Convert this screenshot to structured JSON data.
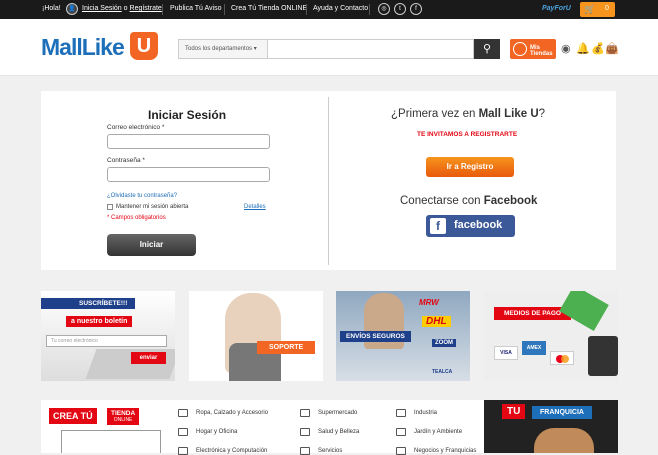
{
  "topbar": {
    "hola": "¡Hola!",
    "inicia": "Inicia Sesión",
    "o": "o",
    "registrate": "Regístrate",
    "publica": "Publica Tú Aviso",
    "crea": "Crea Tú Tienda ONLINE",
    "ayuda": "Ayuda y Contacto",
    "payforu": "PayForU",
    "cart_count": "0",
    "social": [
      "instagram",
      "twitter",
      "facebook"
    ]
  },
  "header": {
    "logo": "MallLike",
    "logo_u": "U",
    "search_dept": "Todos los departamentos",
    "search_placeholder": "",
    "mis_tiendas": "Mis Tiendas"
  },
  "login": {
    "title": "Iniciar Sesión",
    "email_label": "Correo electrónico *",
    "email_value": "",
    "password_label": "Contraseña *",
    "password_value": "",
    "forgot": "¿Olvidaste tu contraseña?",
    "keep": "Mantener mi sesión abierta",
    "details": "Detalles",
    "required": "* Campos obligatorios",
    "submit": "Iniciar"
  },
  "register": {
    "question_pre": "¿Primera vez en",
    "question_brand": "Mall Like U",
    "question_post": "?",
    "invite": "TE INVITAMOS A REGISTRARTE",
    "btn": "Ir a Registro",
    "fb_text": "Conectarse con",
    "fb_bold": "Facebook",
    "fb_btn": "facebook"
  },
  "banners": {
    "newsletter_l1": "SUSCRÍBETE!!!",
    "newsletter_l2": "a nuestro boletín",
    "newsletter_placeholder": "Tu correo electrónico",
    "newsletter_btn": "enviar",
    "soporte": "SOPORTE",
    "envios": "ENVÍOS SEGUROS",
    "mrw": "MRW",
    "dhl": "DHL",
    "zoom": "ZOOM",
    "tealca": "TEALCA",
    "pago": "MEDIOS DE PAGO",
    "visa": "VISA",
    "amex": "AMEX"
  },
  "bottom": {
    "crea": "CREA TÚ",
    "tienda": "TIENDA",
    "online": "ONLINE",
    "tu": "TU",
    "franquicia": "FRANQUICIA"
  },
  "categories": [
    {
      "label": "Ropa, Calzado y Accesorio",
      "icon": "shirt-icon"
    },
    {
      "label": "Supermercado",
      "icon": "basket-icon"
    },
    {
      "label": "Industria",
      "icon": "factory-icon"
    },
    {
      "label": "Hogar y Oficina",
      "icon": "sofa-icon"
    },
    {
      "label": "Salud y Belleza",
      "icon": "health-icon"
    },
    {
      "label": "Jardín y Ambiente",
      "icon": "plant-icon"
    },
    {
      "label": "Electrónica y Computación",
      "icon": "computer-icon"
    },
    {
      "label": "Servicios",
      "icon": "tools-icon"
    },
    {
      "label": "Negocios y Franquicias",
      "icon": "handshake-icon"
    }
  ],
  "colors": {
    "orange": "#f26522",
    "red": "#e30613",
    "blue": "#1e6fba",
    "fb": "#3b5998",
    "dark": "#1a1a1a"
  }
}
